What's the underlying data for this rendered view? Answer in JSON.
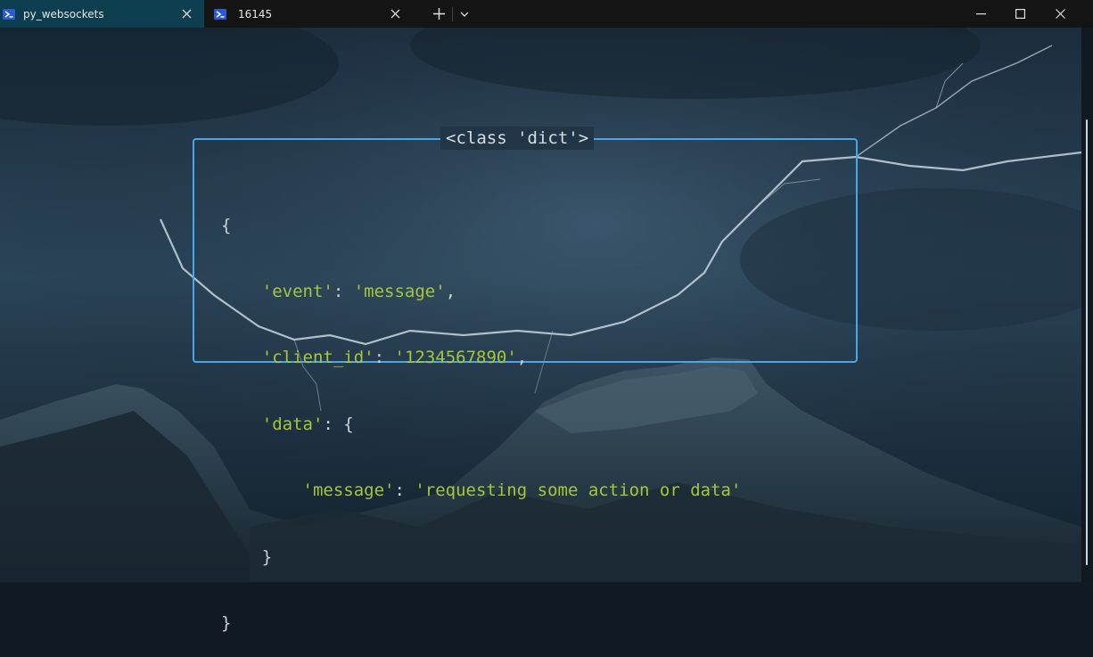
{
  "window": {
    "tabs": [
      {
        "label": "py_websockets",
        "active": true,
        "icon": "powershell-icon"
      },
      {
        "label": "16145",
        "active": false,
        "icon": "powershell-icon"
      }
    ],
    "controls": {
      "new_tab": "+",
      "dropdown": "⌄",
      "minimize": "—",
      "maximize": "☐",
      "close": "✕"
    }
  },
  "panel": {
    "title": "<class 'dict'>",
    "border_color": "#49a6e8"
  },
  "code": {
    "open_brace": "{",
    "close_brace": "}",
    "event_key": "'event'",
    "event_value": "'message'",
    "client_id_key": "'client_id'",
    "client_id_value": "'1234567890'",
    "data_key": "'data'",
    "nested_open": "{",
    "message_key": "'message'",
    "message_value": "'requesting some action or data'",
    "nested_close": "}",
    "colon": ": ",
    "comma": ","
  },
  "colors": {
    "string": "#a5c63a",
    "text": "#c9d2d8",
    "tab_active": "#0d3e4f"
  }
}
